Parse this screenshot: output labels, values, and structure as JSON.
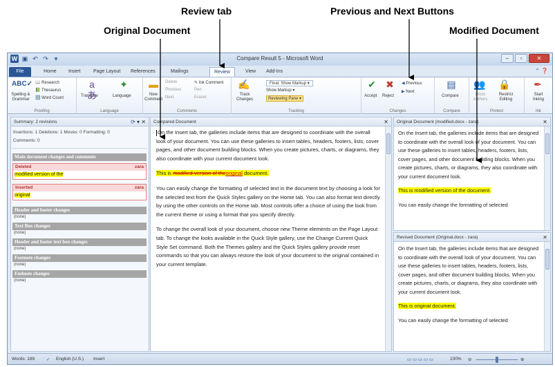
{
  "callouts": {
    "review_tab": "Review tab",
    "original_document": "Original Document",
    "prev_next": "Previous and Next Buttons",
    "modified_document": "Modified Document"
  },
  "window": {
    "title": "Compare Result 5 - Microsoft Word",
    "tabs": [
      "File",
      "Home",
      "Insert",
      "Page Layout",
      "References",
      "Mailings",
      "Review",
      "View",
      "Add-Ins"
    ],
    "active_tab": "Review"
  },
  "ribbon": {
    "proofing": {
      "spelling": "Spelling & Grammar",
      "research": "Research",
      "thesaurus": "Thesaurus",
      "word_count": "Word Count",
      "label": "Proofing"
    },
    "language": {
      "translate": "Translate",
      "language": "Language",
      "label": "Language"
    },
    "comments": {
      "new_comment": "New Comment",
      "delete": "Delete",
      "previous": "Previous",
      "next": "Next",
      "ink_comment": "Ink Comment",
      "pen": "Pen",
      "eraser": "Eraser",
      "label": "Comments"
    },
    "tracking": {
      "track_changes": "Track Changes",
      "final_show_markup": "Final: Show Markup",
      "show_markup": "Show Markup",
      "reviewing_pane": "Reviewing Pane",
      "label": "Tracking"
    },
    "changes": {
      "accept": "Accept",
      "reject": "Reject",
      "previous": "Previous",
      "next": "Next",
      "label": "Changes"
    },
    "compare": {
      "compare": "Compare",
      "label": "Compare"
    },
    "protect": {
      "block_authors": "Block Authors",
      "restrict_editing": "Restrict Editing",
      "label": "Protect"
    },
    "ink": {
      "start_inking": "Start Inking",
      "label": "Ink"
    }
  },
  "summary": {
    "header": "Summary: 2 revisions",
    "counts": "Insertions: 1  Deletions: 1  Moves: 0  Formatting: 0",
    "comments": "Comments: 0",
    "main_section": "Main document changes and comments",
    "revisions": [
      {
        "type": "Deleted",
        "author": "zara",
        "text": "modified version of the"
      },
      {
        "type": "Inserted",
        "author": "zara",
        "text": "original"
      }
    ],
    "other_sections": [
      {
        "title": "Header and footer changes",
        "value": "(none)"
      },
      {
        "title": "Text Box changes",
        "value": "(none)"
      },
      {
        "title": "Header and footer text box changes",
        "value": "(none)"
      },
      {
        "title": "Footnote changes",
        "value": "(none)"
      },
      {
        "title": "Endnote changes",
        "value": "(none)"
      }
    ]
  },
  "compared": {
    "header": "Compared Document",
    "p1": "On the Insert tab, the galleries include items that are designed to coordinate with the overall look of your document. You can use these galleries to insert tables, headers, footers, lists, cover pages, and other document building blocks. When you create pictures, charts, or diagrams, they also coordinate with your current document look.",
    "p2_prefix": "This is ",
    "p2_deleted": "modified version of the",
    "p2_inserted": "original",
    "p2_suffix": " document.",
    "p3": "You can easily change the formatting of selected text in the document text by choosing a look for the selected text from the Quick Styles gallery on the Home tab. You can also format text directly by using the other controls on the Home tab. Most controls offer a choice of using the look from the current theme or using a format that you specify directly.",
    "p4": "To change the overall look of your document, choose new Theme elements on the Page Layout tab. To change the looks available in the Quick Style gallery, use the Change Current Quick Style Set command. Both the Themes gallery and the Quick Styles gallery provide reset commands so that you can always restore the look of your document to the original contained in your current template."
  },
  "original_pane": {
    "header": "Original Document (modified.docx - zara)",
    "p1": "On the Insert tab, the galleries include items that are designed to coordinate with the overall look of your document. You can use these galleries to insert tables, headers, footers, lists, cover pages, and other document building blocks. When you create pictures, charts, or diagrams, they also coordinate with your current document look.",
    "p2": "This is modified version of the document.",
    "p3": "You can easily change the formatting of selected"
  },
  "revised_pane": {
    "header": "Revised Document (Original.docx - zara)",
    "p1": "On the Insert tab, the galleries include items that are designed to coordinate with the overall look of your document. You can use these galleries to insert tables, headers, footers, lists, cover pages, and other document building blocks. When you create pictures, charts, or diagrams, they also coordinate with your current document look.",
    "p2": "This is original document.",
    "p3": "You can easily change the formatting of selected"
  },
  "status": {
    "words": "Words: 189",
    "language": "English (U.S.)",
    "mode": "Insert",
    "zoom": "100%"
  },
  "colors": {
    "highlight": "#ffff00",
    "deletion": "#c00000",
    "file_tab": "#2b5797",
    "section_header": "#a6a6a6"
  }
}
